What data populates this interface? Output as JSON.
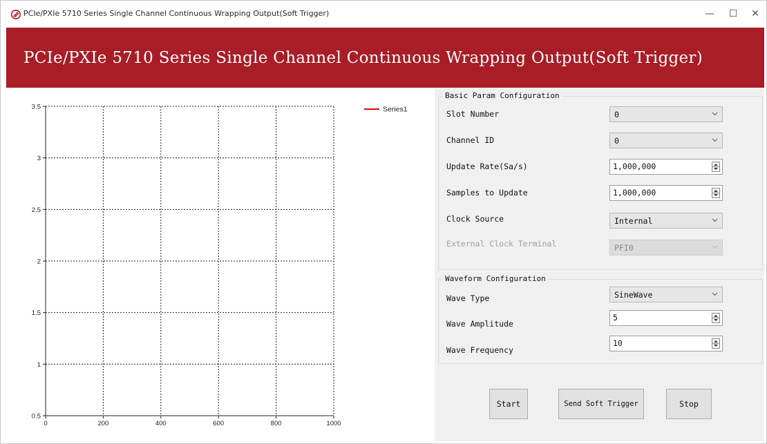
{
  "window": {
    "title": "PCIe/PXIe 5710 Series Single Channel Continuous Wrapping Output(Soft Trigger)",
    "minimize_glyph": "—",
    "maximize_glyph": "☐",
    "close_glyph": "✕"
  },
  "banner": {
    "title": "PCIe/PXIe 5710 Series Single Channel Continuous Wrapping Output(Soft Trigger)",
    "color": "#a81d26"
  },
  "basic_config": {
    "title": "Basic Param Configuration",
    "slot_number": {
      "label": "Slot Number",
      "value": "0"
    },
    "channel_id": {
      "label": "Channel ID",
      "value": "0"
    },
    "update_rate": {
      "label": "Update Rate(Sa/s)",
      "value": "1,000,000"
    },
    "samples_to_update": {
      "label": "Samples to Update",
      "value": "1,000,000"
    },
    "clock_source": {
      "label": "Clock Source",
      "value": "Internal"
    },
    "external_clock_terminal": {
      "label": "External Clock Terminal",
      "value": "PFI0"
    }
  },
  "waveform_config": {
    "title": "Waveform Configuration",
    "wave_type": {
      "label": "Wave Type",
      "value": "SineWave"
    },
    "wave_amplitude": {
      "label": "Wave Amplitude",
      "value": "5"
    },
    "wave_frequency": {
      "label": "Wave Frequency",
      "value": "10"
    }
  },
  "buttons": {
    "start": "Start",
    "send_soft_trigger": "Send Soft Trigger",
    "stop": "Stop"
  },
  "chart_data": {
    "type": "line",
    "title": "",
    "xlabel": "",
    "ylabel": "",
    "xlim": [
      0,
      1000
    ],
    "ylim": [
      0.5,
      3.5
    ],
    "x_ticks": [
      "0",
      "200",
      "400",
      "600",
      "800",
      "1000"
    ],
    "y_ticks": [
      "0.5",
      "1",
      "1.5",
      "2",
      "2.5",
      "3",
      "3.5"
    ],
    "grid": true,
    "legend_position": "top-right",
    "series": [
      {
        "name": "Series1",
        "color": "#e00000",
        "x": [],
        "y": []
      }
    ]
  }
}
